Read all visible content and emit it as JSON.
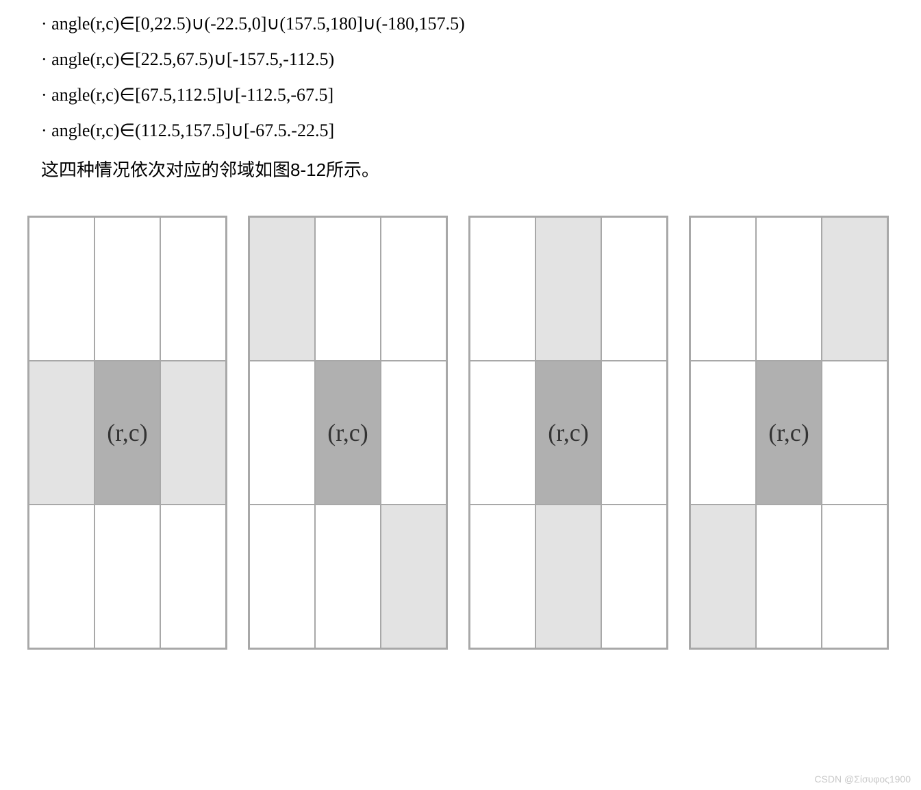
{
  "formulas": {
    "line1": "· angle(r,c)∈[0,22.5)∪(-22.5,0]∪(157.5,180]∪(-180,157.5)",
    "line2": "· angle(r,c)∈[22.5,67.5)∪[-157.5,-112.5)",
    "line3": "· angle(r,c)∈[67.5,112.5]∪[-112.5,-67.5]",
    "line4": "· angle(r,c)∈(112.5,157.5]∪[-67.5.-22.5]"
  },
  "caption": "这四种情况依次对应的邻域如图8-12所示。",
  "center_label": "(r,c)",
  "watermark": "CSDN @Σίσυφος1900",
  "grids": [
    {
      "cells": [
        {
          "shade": "white"
        },
        {
          "shade": "white"
        },
        {
          "shade": "white"
        },
        {
          "shade": "light"
        },
        {
          "shade": "dark",
          "label": true
        },
        {
          "shade": "light"
        },
        {
          "shade": "white"
        },
        {
          "shade": "white"
        },
        {
          "shade": "white"
        }
      ]
    },
    {
      "cells": [
        {
          "shade": "light"
        },
        {
          "shade": "white"
        },
        {
          "shade": "white"
        },
        {
          "shade": "white"
        },
        {
          "shade": "dark",
          "label": true
        },
        {
          "shade": "white"
        },
        {
          "shade": "white"
        },
        {
          "shade": "white"
        },
        {
          "shade": "light"
        }
      ]
    },
    {
      "cells": [
        {
          "shade": "white"
        },
        {
          "shade": "light"
        },
        {
          "shade": "white"
        },
        {
          "shade": "white"
        },
        {
          "shade": "dark",
          "label": true
        },
        {
          "shade": "white"
        },
        {
          "shade": "white"
        },
        {
          "shade": "light"
        },
        {
          "shade": "white"
        }
      ]
    },
    {
      "cells": [
        {
          "shade": "white"
        },
        {
          "shade": "white"
        },
        {
          "shade": "light"
        },
        {
          "shade": "white"
        },
        {
          "shade": "dark",
          "label": true
        },
        {
          "shade": "white"
        },
        {
          "shade": "light"
        },
        {
          "shade": "white"
        },
        {
          "shade": "white"
        }
      ]
    }
  ]
}
